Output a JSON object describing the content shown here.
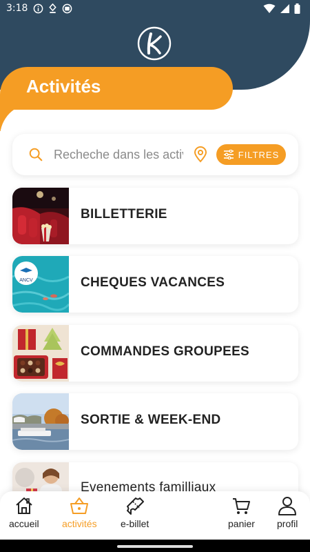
{
  "status_bar": {
    "time": "3:18"
  },
  "header": {
    "title": "Activités"
  },
  "search": {
    "placeholder": "Recheche dans les activités",
    "filter_label": "FILTRES"
  },
  "categories": [
    {
      "label": "BILLETTERIE"
    },
    {
      "label": "CHEQUES VACANCES",
      "thumb_text": "ANCV"
    },
    {
      "label": "COMMANDES GROUPEES"
    },
    {
      "label": "SORTIE & WEEK-END"
    },
    {
      "label": "Evenements familliaux"
    }
  ],
  "nav": [
    {
      "label": "accueil",
      "icon": "home-icon"
    },
    {
      "label": "activités",
      "icon": "basket-icon",
      "active": true
    },
    {
      "label": "e-billet",
      "icon": "ticket-icon"
    },
    {
      "label": "panier",
      "icon": "cart-icon"
    },
    {
      "label": "profil",
      "icon": "user-icon"
    }
  ],
  "colors": {
    "accent": "#f59d24",
    "header": "#2f4a60"
  }
}
